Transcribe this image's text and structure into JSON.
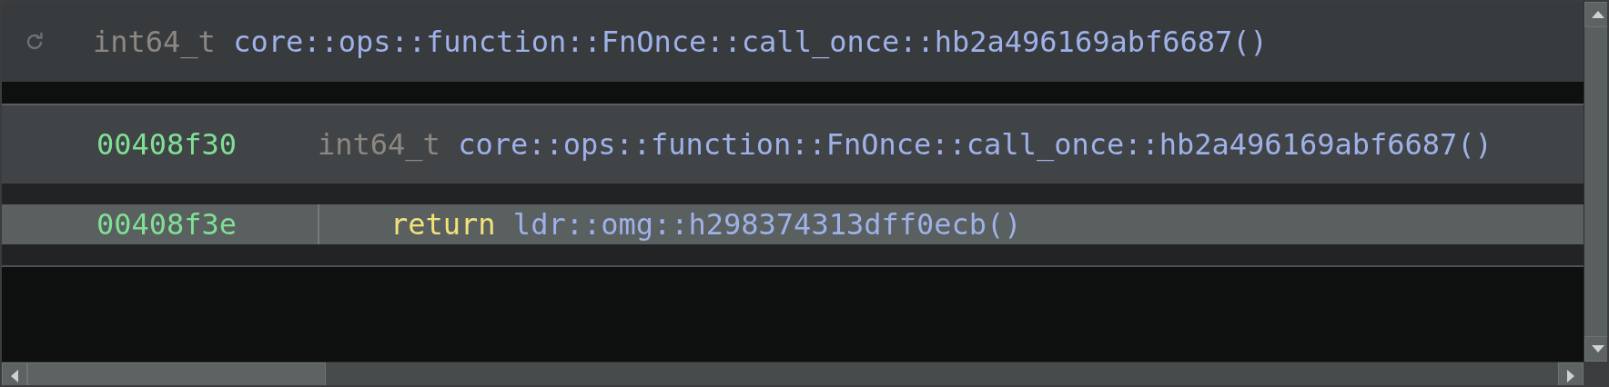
{
  "header": {
    "return_type": "int64_t",
    "name": "core::ops::function::FnOnce::call_once::hb2a496169abf6687()"
  },
  "function": {
    "address": "00408f30",
    "return_type": "int64_t",
    "name": "core::ops::function::FnOnce::call_once::hb2a496169abf6687()"
  },
  "lines": [
    {
      "address": "00408f3e",
      "keyword": "return",
      "text": "ldr::omg::h298374313dff0ecb()",
      "selected": true
    }
  ]
}
